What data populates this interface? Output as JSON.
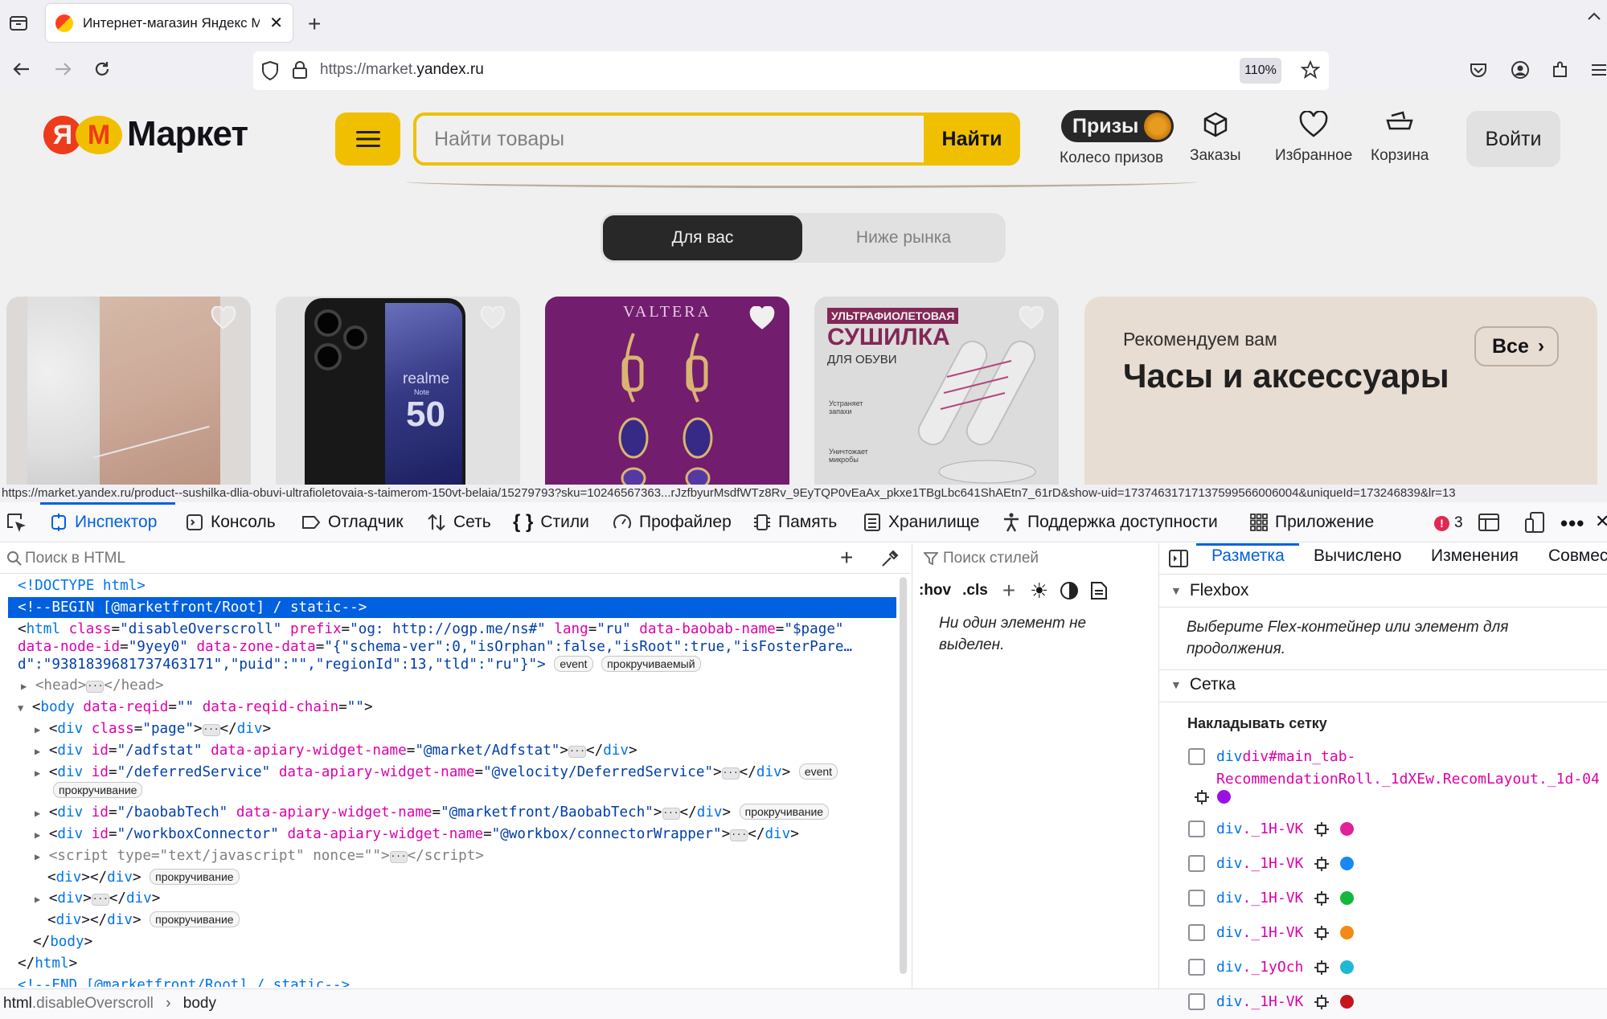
{
  "browser": {
    "tab_title": "Интернет-магазин Яндекс Маркет",
    "url_prefix": "https://market.",
    "url_domain": "yandex.ru",
    "zoom": "110%",
    "status_url": "https://market.yandex.ru/product--sushilka-dlia-obuvi-ultrafioletovaia-s-taimerom-150vt-belaia/15279793?sku=10246567363...rJzfbyurMsdfWTz8Rv_9EyTQP0vEaAx_pkxe1TBgLbc641ShAEtn7_61rD&show-uid=17374631717137599566006004&uniqueId=173246839&lr=13"
  },
  "market": {
    "logo_ya": "Я",
    "logo_m": "М",
    "logo_text": "Маркет",
    "search_placeholder": "Найти товары",
    "search_button": "Найти",
    "prizes_badge": "Призы",
    "prizes_label": "Колесо призов",
    "orders_label": "Заказы",
    "favorites_label": "Избранное",
    "cart_label": "Корзина",
    "login_button": "Войти",
    "segment_for_you": "Для вас",
    "segment_below_market": "Ниже рынка",
    "card_phone_brand": "realme",
    "card_phone_model_note": "Note",
    "card_phone_model_num": "50",
    "card_earrings_brand": "VALTERA",
    "card_dryer_line1": "УЛЬТРАФИОЛЕТОВАЯ",
    "card_dryer_line2": "СУШИЛКА",
    "card_dryer_line3": "ДЛЯ ОБУВИ",
    "card_dryer_feat1": "Устраняет запахи",
    "card_dryer_feat2": "Уничтожает микробы",
    "reco_subtitle": "Рекомендуем вам",
    "reco_title": "Часы и аксессуары",
    "reco_all": "Все"
  },
  "devtools": {
    "tabs": [
      "Инспектор",
      "Консоль",
      "Отладчик",
      "Сеть",
      "Стили",
      "Профайлер",
      "Память",
      "Хранилище",
      "Поддержка доступности",
      "Приложение"
    ],
    "error_count": "3",
    "html_search_placeholder": "Поиск в HTML",
    "markup": {
      "doctype": "<!DOCTYPE html>",
      "begin_comment": "<!--BEGIN [@marketfront/Root] / static-->",
      "html_line1_class": "\"disableOverscroll\"",
      "html_line1_prefix": "\"og: http://ogp.me/ns#\"",
      "html_line1_lang": "\"ru\"",
      "html_line1_baobab": "\"$page\"",
      "html_line2_nodeid": "\"9yey0\"",
      "html_line2_zone": "\"{\"schema-ver\":0,\"isOrphan\":false,\"isRoot\":true,\"isFosterPare…",
      "html_line3": "d\":\"9381839681737463171\",\"puid\":\"\",\"regionId\":13,\"tld\":\"ru\"}\">",
      "badge_event": "event",
      "badge_scrollable": "прокручиваемый",
      "badge_scrolling": "прокручивание",
      "div_page_class": "\"page\"",
      "div_adfstat_id": "\"/adfstat\"",
      "div_adfstat_widget": "\"@market/Adfstat\"",
      "div_deferred_id": "\"/deferredService\"",
      "div_deferred_widget": "\"@velocity/DeferredService\"",
      "div_baobab_id": "\"/baobabTech\"",
      "div_baobab_widget": "\"@marketfront/BaobabTech\"",
      "div_workbox_id": "\"/workboxConnector\"",
      "div_workbox_widget": "\"@workbox/connectorWrapper\"",
      "script_type": "\"text/javascript\"",
      "end_comment": "<!--END [@marketfront/Root] / static-->"
    },
    "breadcrumb_html": "html",
    "breadcrumb_html_class": ".disableOverscroll",
    "breadcrumb_body": "body",
    "styles_search_placeholder": "Поиск стилей",
    "styles_hov": ":hov",
    "styles_cls": ".cls",
    "styles_empty": "Ни один элемент не выделен.",
    "layout_tabs": [
      "Разметка",
      "Вычислено",
      "Изменения",
      "Совмес"
    ],
    "flexbox_title": "Flexbox",
    "flexbox_note": "Выберите Flex-контейнер или элемент для продолжения.",
    "grid_title": "Сетка",
    "grid_overlay_title": "Накладывать сетку",
    "grid_first_line1": "div#main_tab-",
    "grid_first_line2": "RecommendationRoll._1dXEw.RecomLayout._1d-04",
    "grid_items": [
      {
        "name": "div._1H-VK",
        "color": "#e0219a"
      },
      {
        "name": "div._1H-VK",
        "color": "#1a87f5"
      },
      {
        "name": "div._1H-VK",
        "color": "#15b83a"
      },
      {
        "name": "div._1H-VK",
        "color": "#f28a16"
      },
      {
        "name": "div._1yOch",
        "color": "#23b7d6"
      },
      {
        "name": "div._1H-VK",
        "color": "#c4151c"
      }
    ],
    "grid_first_color": "#9b11e5"
  }
}
